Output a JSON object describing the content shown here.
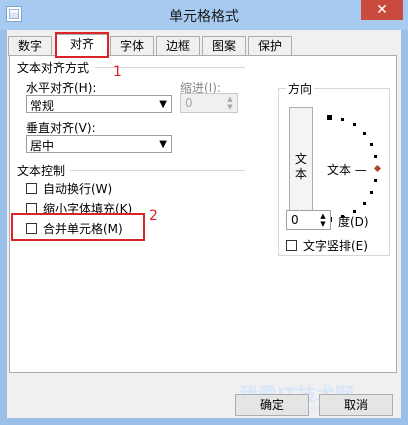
{
  "window": {
    "title": "单元格格式",
    "close_glyph": "✕"
  },
  "tabs": [
    {
      "label": "数字",
      "active": false
    },
    {
      "label": "对齐",
      "active": true
    },
    {
      "label": "字体",
      "active": false
    },
    {
      "label": "边框",
      "active": false
    },
    {
      "label": "图案",
      "active": false
    },
    {
      "label": "保护",
      "active": false
    }
  ],
  "alignment": {
    "section_title": "文本对齐方式",
    "horizontal_label": "水平对齐(H):",
    "horizontal_value": "常规",
    "indent_label": "缩进(I):",
    "indent_value": "0",
    "vertical_label": "垂直对齐(V):",
    "vertical_value": "居中"
  },
  "control": {
    "section_title": "文本控制",
    "wrap_label": "自动换行(W)",
    "shrink_label": "缩小字体填充(K)",
    "merge_label": "合并单元格(M)"
  },
  "orientation": {
    "title": "方向",
    "vertical_text": "文本",
    "dial_text": "文本 —",
    "degree_value": "0",
    "degree_label": "度(D)",
    "vertical_checkbox_label": "文字竖排(E)"
  },
  "buttons": {
    "ok": "确定",
    "cancel": "取消"
  },
  "annotations": {
    "n1": "1",
    "n2": "2",
    "color": "#d9242a"
  },
  "watermark": {
    "line1": "我爱IT技术网",
    "line2": "www.52ij.com"
  }
}
